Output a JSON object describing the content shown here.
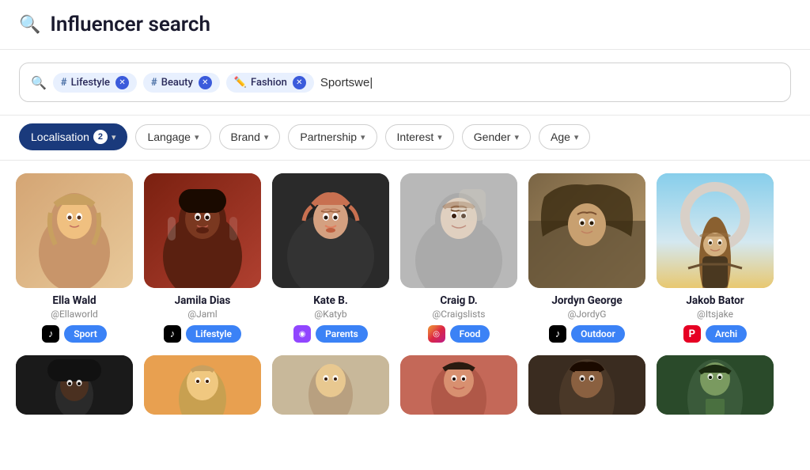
{
  "header": {
    "icon": "🔍",
    "title": "Influencer search"
  },
  "searchbar": {
    "tags": [
      {
        "id": "lifestyle",
        "prefix": "#",
        "label": "Lifestyle",
        "type": "hashtag"
      },
      {
        "id": "beauty",
        "prefix": "#",
        "label": "Beauty",
        "type": "hashtag"
      },
      {
        "id": "fashion",
        "prefix": "✏️",
        "label": "Fashion",
        "type": "pen"
      }
    ],
    "input_value": "Sportswe|",
    "input_placeholder": ""
  },
  "filters": [
    {
      "id": "localisation",
      "label": "Localisation",
      "badge": "2",
      "active": true
    },
    {
      "id": "langage",
      "label": "Langage",
      "badge": null,
      "active": false
    },
    {
      "id": "brand",
      "label": "Brand",
      "badge": null,
      "active": false
    },
    {
      "id": "partnership",
      "label": "Partnership",
      "badge": null,
      "active": false
    },
    {
      "id": "interest",
      "label": "Interest",
      "badge": null,
      "active": false
    },
    {
      "id": "gender",
      "label": "Gender",
      "badge": null,
      "active": false
    },
    {
      "id": "age",
      "label": "Age",
      "badge": null,
      "active": false
    }
  ],
  "influencers_row1": [
    {
      "id": "ella",
      "name": "Ella Wald",
      "handle": "@Ellaworld",
      "social": "tiktok",
      "badge": "Sport",
      "face": "ella"
    },
    {
      "id": "jamila",
      "name": "Jamila Dias",
      "handle": "@Jaml",
      "social": "tiktok",
      "badge": "Lifestyle",
      "face": "jamila"
    },
    {
      "id": "kate",
      "name": "Kate B.",
      "handle": "@Katyb",
      "social": "twitch",
      "badge": "Parents",
      "face": "kate"
    },
    {
      "id": "craig",
      "name": "Craig D.",
      "handle": "@Craigslists",
      "social": "instagram",
      "badge": "Food",
      "face": "craig"
    },
    {
      "id": "jordyn",
      "name": "Jordyn George",
      "handle": "@JordyG",
      "social": "tiktok",
      "badge": "Outdoor",
      "face": "jordyn"
    },
    {
      "id": "jakob",
      "name": "Jakob Bator",
      "handle": "@Itsjake",
      "social": "pinterest",
      "badge": "Archi",
      "face": "jakob"
    }
  ],
  "influencers_row2": [
    {
      "id": "r1",
      "name": "",
      "handle": "",
      "social": "tiktok",
      "badge": "",
      "face": "r1"
    },
    {
      "id": "r2",
      "name": "",
      "handle": "",
      "social": "tiktok",
      "badge": "",
      "face": "r2"
    },
    {
      "id": "r3",
      "name": "",
      "handle": "",
      "social": "tiktok",
      "badge": "",
      "face": "r3"
    },
    {
      "id": "r4",
      "name": "",
      "handle": "",
      "social": "instagram",
      "badge": "",
      "face": "r4"
    },
    {
      "id": "r5",
      "name": "",
      "handle": "",
      "social": "tiktok",
      "badge": "",
      "face": "r5"
    },
    {
      "id": "r6",
      "name": "",
      "handle": "",
      "social": "tiktok",
      "badge": "",
      "face": "r6"
    }
  ],
  "icons": {
    "search": "🔍",
    "tiktok": "♪",
    "twitch": "◉",
    "instagram": "◎",
    "pinterest": "P",
    "chevron": "▾",
    "close": "✕"
  }
}
